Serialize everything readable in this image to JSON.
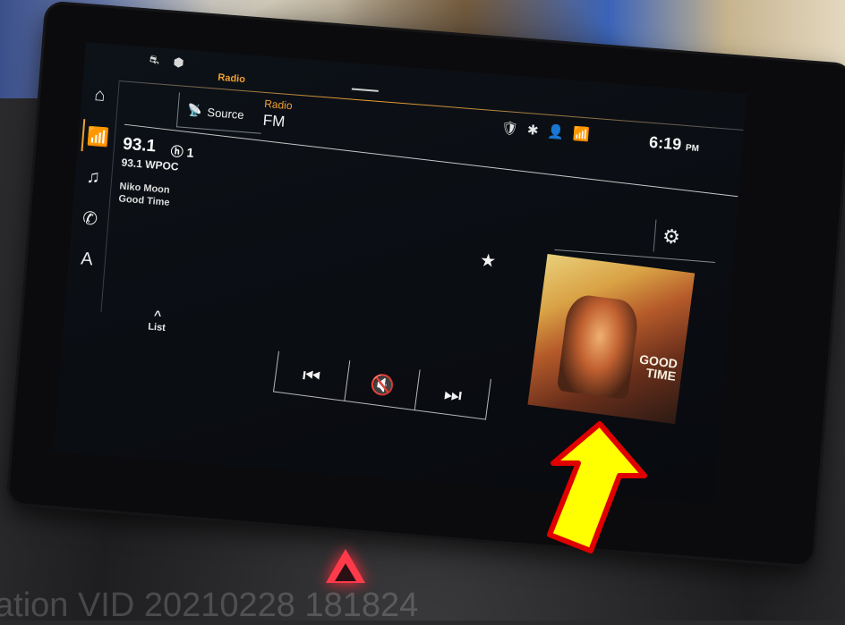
{
  "status": {
    "top_icons": "⛐ ⬢",
    "clock": "6:19",
    "clock_suffix": "PM"
  },
  "app": {
    "title": "Radio"
  },
  "source": {
    "label": "Source",
    "icon": "wifi-icon"
  },
  "band": {
    "label": "Radio",
    "value": "FM"
  },
  "station": {
    "frequency": "93.1",
    "hd_channel": "1",
    "name": "93.1 WPOC",
    "artist": "Niko Moon",
    "song": "Good Time"
  },
  "list": {
    "label": "List"
  },
  "album": {
    "text_line1": "GOOD",
    "text_line2": "TIME"
  },
  "transport": {
    "prev": "⏮",
    "mute": "🔇",
    "next": "⏭"
  },
  "overlay": {
    "text": "ation VID 20210228 181824"
  },
  "colors": {
    "accent": "#f0a030",
    "screen_bg": "#0a0d12",
    "arrow_fill": "#ffff00",
    "arrow_stroke": "#e00000"
  }
}
